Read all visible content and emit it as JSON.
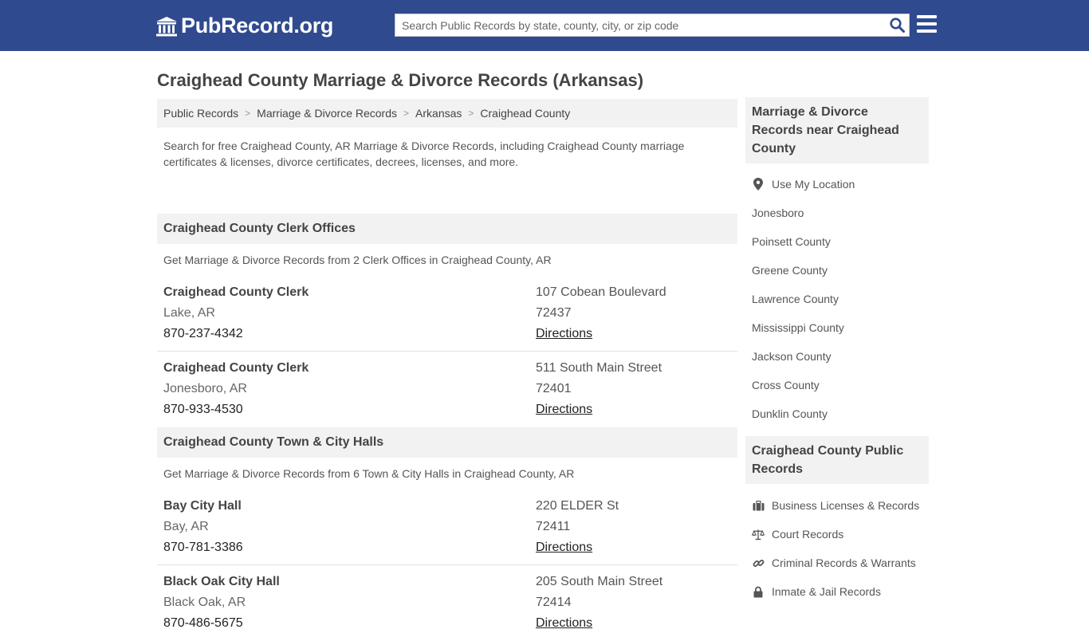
{
  "header": {
    "logo_text": "PubRecord.org",
    "search_placeholder": "Search Public Records by state, county, city, or zip code"
  },
  "page_title": "Craighead County Marriage & Divorce Records (Arkansas)",
  "breadcrumb": [
    "Public Records",
    "Marriage & Divorce Records",
    "Arkansas",
    "Craighead County"
  ],
  "intro": "Search for free Craighead County, AR Marriage & Divorce Records, including Craighead County marriage certificates & licenses, divorce certificates, decrees, licenses, and more.",
  "sections": [
    {
      "title": "Craighead County Clerk Offices",
      "subtitle": "Get Marriage & Divorce Records from 2 Clerk Offices in Craighead County, AR",
      "offices": [
        {
          "name": "Craighead County Clerk",
          "city": "Lake, AR",
          "phone": "870-237-4342",
          "address": "107 Cobean Boulevard",
          "zip": "72437",
          "directions": "Directions"
        },
        {
          "name": "Craighead County Clerk",
          "city": "Jonesboro, AR",
          "phone": "870-933-4530",
          "address": "511 South Main Street",
          "zip": "72401",
          "directions": "Directions"
        }
      ]
    },
    {
      "title": "Craighead County Town & City Halls",
      "subtitle": "Get Marriage & Divorce Records from 6 Town & City Halls in Craighead County, AR",
      "offices": [
        {
          "name": "Bay City Hall",
          "city": "Bay, AR",
          "phone": "870-781-3386",
          "address": "220 ELDER St",
          "zip": "72411",
          "directions": "Directions"
        },
        {
          "name": "Black Oak City Hall",
          "city": "Black Oak, AR",
          "phone": "870-486-5675",
          "address": "205 South Main Street",
          "zip": "72414",
          "directions": "Directions"
        }
      ]
    }
  ],
  "sidebar": {
    "nearby_title": "Marriage & Divorce Records near Craighead County",
    "use_location": "Use My Location",
    "nearby": [
      "Jonesboro",
      "Poinsett County",
      "Greene County",
      "Lawrence County",
      "Mississippi County",
      "Jackson County",
      "Cross County",
      "Dunklin County"
    ],
    "public_title": "Craighead County Public Records",
    "public_records": [
      {
        "label": "Business Licenses & Records",
        "icon": "briefcase-icon"
      },
      {
        "label": "Court Records",
        "icon": "scales-icon"
      },
      {
        "label": "Criminal Records & Warrants",
        "icon": "link-icon"
      },
      {
        "label": "Inmate & Jail Records",
        "icon": "lock-icon"
      }
    ]
  },
  "colors": {
    "header_bg": "#2f4a8f",
    "panel_bg": "#f2f2f2",
    "search_icon": "#2f4a8f"
  }
}
